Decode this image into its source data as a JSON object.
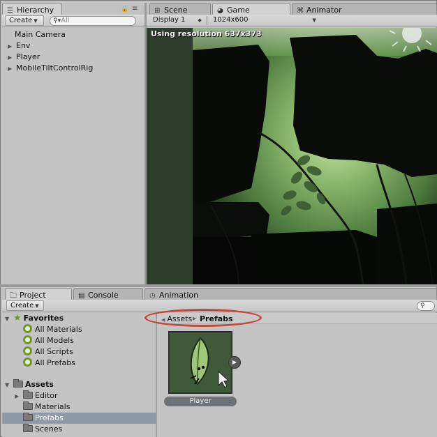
{
  "hierarchy": {
    "tab_label": "Hierarchy",
    "create_label": "Create",
    "search_placeholder": "All",
    "items": [
      "Main Camera",
      "Env",
      "Player",
      "MobileTiltControlRig"
    ]
  },
  "view_tabs": [
    "Scene",
    "Game",
    "Animator"
  ],
  "game": {
    "display_label": "Display 1",
    "resolution_label": "1024x600",
    "overlay_text": "Using resolution 637x373"
  },
  "project": {
    "tabs": [
      "Project",
      "Console",
      "Animation"
    ],
    "create_label": "Create",
    "favorites": {
      "label": "Favorites",
      "items": [
        "All Materials",
        "All Models",
        "All Scripts",
        "All Prefabs"
      ]
    },
    "assets": {
      "label": "Assets",
      "folders": [
        "Editor",
        "Materials",
        "Prefabs",
        "Scenes"
      ],
      "selected": "Prefabs"
    },
    "breadcrumb": [
      "Assets",
      "Prefabs"
    ],
    "asset_item": {
      "label": "Player"
    }
  },
  "icons": {
    "hierarchy": "list-icon",
    "scene": "grid-icon",
    "game": "pacman-icon",
    "animator": "graph-icon",
    "project": "folder-icon",
    "console": "console-icon",
    "animation": "clock-icon",
    "favorites": "star-icon",
    "search": "magnifier-icon",
    "lock": "lock-icon",
    "menu": "menu-icon",
    "play": "play-arrow-icon"
  },
  "colors": {
    "annotation_oval": "#c24a3a",
    "selection": "#8f9aa8",
    "game_bg": "#2f3d2c"
  }
}
